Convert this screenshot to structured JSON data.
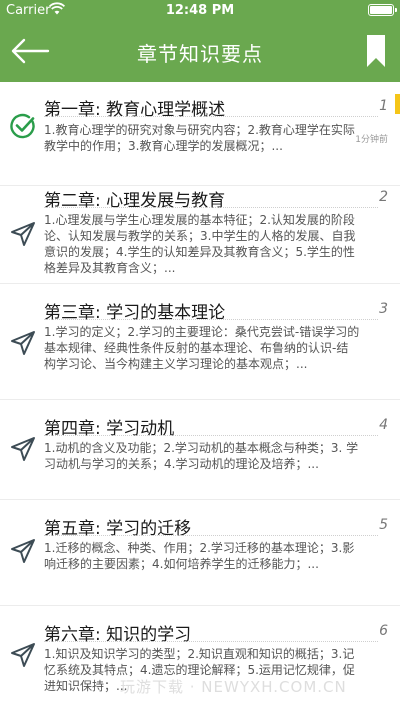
{
  "status": {
    "carrier": "Carrier",
    "time": "12:48 PM"
  },
  "header": {
    "title": "章节知识要点",
    "back_icon": "back-arrow-icon",
    "bookmark_icon": "bookmark-icon"
  },
  "colors": {
    "header_bg": "#6aa84f",
    "accent_green": "#2a9d4a",
    "marker_yellow": "#f5c518"
  },
  "chapters": [
    {
      "title": "第一章:  教育心理学概述",
      "number": "1",
      "description": "1.教育心理学的研究对象与研究内容；2.教育心理学在实际教学中的作用；3.教育心理学的发展概况；...",
      "time_ago": "1分钟前",
      "status_icon": "check-circle-icon"
    },
    {
      "title": "第二章:  心理发展与教育",
      "number": "2",
      "description": "1.心理发展与学生心理发展的基本特征；2.认知发展的阶段论、认知发展与教学的关系；3.中学生的人格的发展、自我意识的发展；4.学生的认知差异及其教育含义；5.学生的性格差异及其教育含义；...",
      "status_icon": "paper-plane-icon"
    },
    {
      "title": "第三章:  学习的基本理论",
      "number": "3",
      "description": "1.学习的定义；2.学习的主要理论：桑代克尝试-错误学习的基本规律、经典性条件反射的基本理论、布鲁纳的认识-结构学习论、当今构建主义学习理论的基本观点；...",
      "status_icon": "paper-plane-icon"
    },
    {
      "title": "第四章:  学习动机",
      "number": "4",
      "description": "1.动机的含义及功能；2.学习动机的基本概念与种类；3. 学习动机与学习的关系；4.学习动机的理论及培养；...",
      "status_icon": "paper-plane-icon"
    },
    {
      "title": "第五章:  学习的迁移",
      "number": "5",
      "description": "1.迁移的概念、种类、作用；2.学习迁移的基本理论；3.影响迁移的主要因素；4.如何培养学生的迁移能力；...",
      "status_icon": "paper-plane-icon"
    },
    {
      "title": "第六章:  知识的学习",
      "number": "6",
      "description": "1.知识及知识学习的类型；2.知识直观和知识的概括；3.记忆系统及其特点；4.遗忘的理论解释；5.运用记忆规律，促进知识保持；...",
      "status_icon": "paper-plane-icon"
    }
  ],
  "watermark": "玩游下载 · NEWYXH.COM.CN"
}
